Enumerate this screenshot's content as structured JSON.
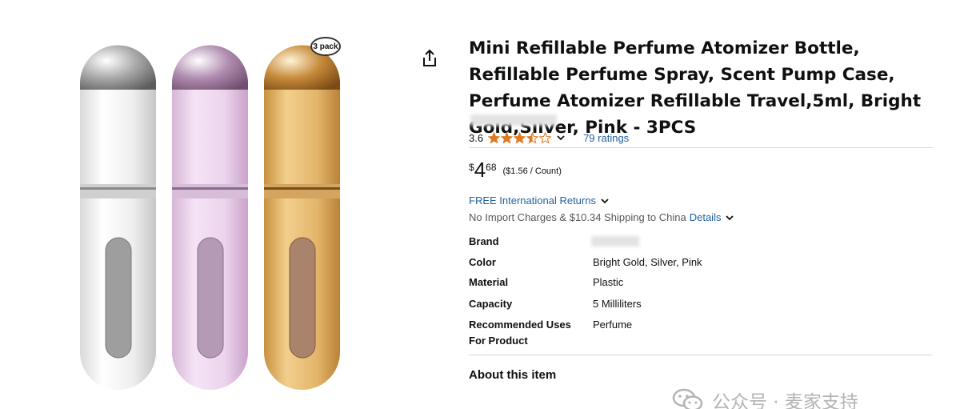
{
  "product": {
    "title": "Mini Refillable Perfume Atomizer Bottle, Refillable Perfume Spray, Scent Pump Case, Perfume Atomizer Refillable Travel,5ml, Bright Gold,Silver, Pink - 3PCS",
    "pack_badge": "3 pack",
    "image_icon": "perfume-bottles-image"
  },
  "rating": {
    "value": "3.6",
    "stars_value": 3.6,
    "stars_max": 5,
    "count_label": "79 ratings",
    "star_color": "#de7921"
  },
  "price": {
    "symbol": "$",
    "whole": "4",
    "fraction": "68",
    "unit_price": "($1.56 / Count)"
  },
  "delivery": {
    "returns": "FREE International Returns",
    "shipping": "No Import Charges & $10.34 Shipping to China",
    "details_link": "Details"
  },
  "specs": [
    {
      "label": "Brand",
      "value": ""
    },
    {
      "label": "Color",
      "value": "Bright Gold, Silver, Pink"
    },
    {
      "label": "Material",
      "value": "Plastic"
    },
    {
      "label": "Capacity",
      "value": "5 Milliliters"
    },
    {
      "label": "Recommended Uses For Product",
      "value": "Perfume"
    }
  ],
  "about_heading": "About this item",
  "watermark": {
    "text": "公众号 · 麦家支持",
    "icon": "wechat-icon"
  },
  "icons": {
    "share": "share-icon",
    "chevron": "chevron-down-icon",
    "star": "star-icon"
  },
  "colors": {
    "link": "#2162a1",
    "text": "#0f1111",
    "muted": "#565959",
    "star": "#de7921",
    "divider": "#d5d9d9"
  }
}
